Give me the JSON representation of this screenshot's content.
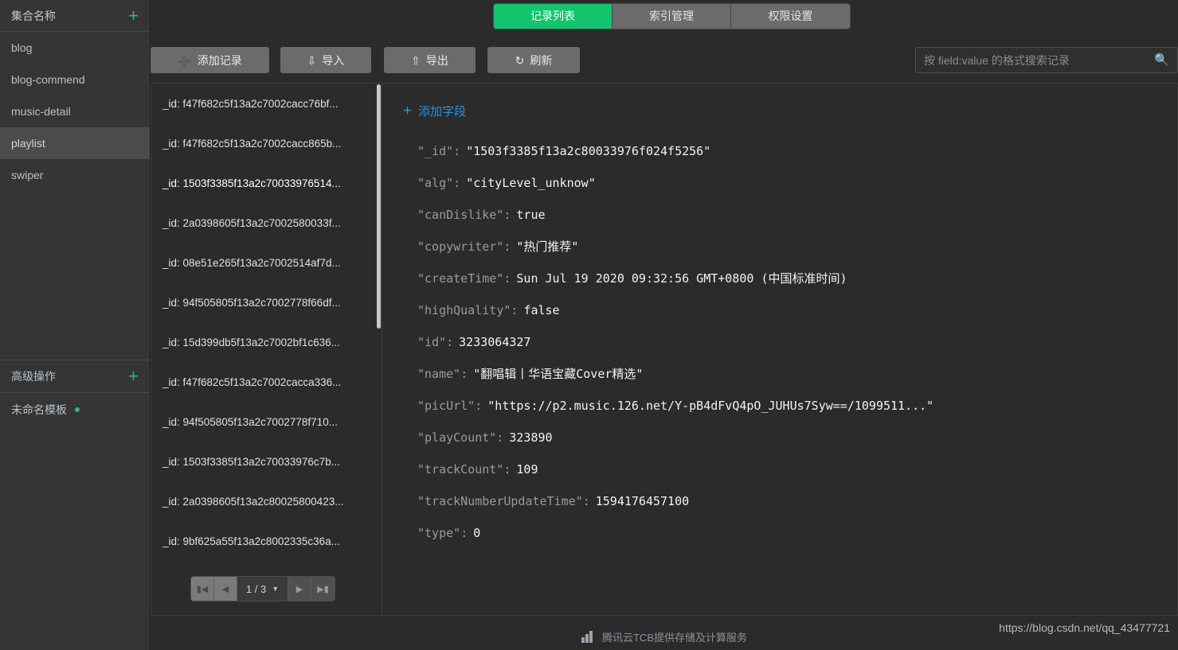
{
  "sidebar": {
    "header": {
      "title": "集合名称",
      "add_icon": "plus-icon"
    },
    "collections": [
      {
        "label": "blog",
        "active": false
      },
      {
        "label": "blog-commend",
        "active": false
      },
      {
        "label": "music-detail",
        "active": false
      },
      {
        "label": "playlist",
        "active": true
      },
      {
        "label": "swiper",
        "active": false
      }
    ],
    "advanced": {
      "title": "高级操作",
      "add_icon": "plus-icon"
    },
    "template": {
      "label": "未命名模板",
      "status_color": "#2eb87a"
    }
  },
  "tabs": [
    {
      "label": "记录列表",
      "active": true
    },
    {
      "label": "索引管理",
      "active": false
    },
    {
      "label": "权限设置",
      "active": false
    }
  ],
  "toolbar": {
    "add_record": {
      "label": "添加记录",
      "icon": "plus-icon"
    },
    "import": {
      "label": "导入",
      "icon": "download-arrow-icon"
    },
    "export": {
      "label": "导出",
      "icon": "upload-arrow-icon"
    },
    "refresh": {
      "label": "刷新",
      "icon": "refresh-icon"
    }
  },
  "search": {
    "placeholder": "按 field:value 的格式搜索记录",
    "value": "",
    "icon": "search-icon"
  },
  "record_list": [
    {
      "label": "_id: f47f682c5f13a2c7002cacc76bf...",
      "selected": false
    },
    {
      "label": "_id: f47f682c5f13a2c7002cacc865b...",
      "selected": false
    },
    {
      "label": "_id: 1503f3385f13a2c70033976514...",
      "selected": true
    },
    {
      "label": "_id: 2a0398605f13a2c7002580033f...",
      "selected": false
    },
    {
      "label": "_id: 08e51e265f13a2c7002514af7d...",
      "selected": false
    },
    {
      "label": "_id: 94f505805f13a2c7002778f66df...",
      "selected": false
    },
    {
      "label": "_id: 15d399db5f13a2c7002bf1c636...",
      "selected": false
    },
    {
      "label": "_id: f47f682c5f13a2c7002cacca336...",
      "selected": false
    },
    {
      "label": "_id: 94f505805f13a2c7002778f710...",
      "selected": false
    },
    {
      "label": "_id: 1503f3385f13a2c70033976c7b...",
      "selected": false
    },
    {
      "label": "_id: 2a0398605f13a2c80025800423...",
      "selected": false
    },
    {
      "label": "_id: 9bf625a55f13a2c8002335c36a...",
      "selected": false
    }
  ],
  "pagination": {
    "first_icon": "first-page-icon",
    "prev_icon": "prev-page-icon",
    "page_text": "1 / 3",
    "caret_icon": "chevron-down-icon",
    "next_icon": "next-page-icon",
    "last_icon": "last-page-icon",
    "first_disabled": true,
    "prev_disabled": true
  },
  "detail": {
    "add_field": {
      "label": "添加字段",
      "icon": "plus-icon",
      "color": "#2f8fd6"
    },
    "fields": [
      {
        "key": "\"_id\"",
        "value": "\"1503f3385f13a2c80033976f024f5256\""
      },
      {
        "key": "\"alg\"",
        "value": "\"cityLevel_unknow\""
      },
      {
        "key": "\"canDislike\"",
        "value": "true"
      },
      {
        "key": "\"copywriter\"",
        "value": "\"热门推荐\""
      },
      {
        "key": "\"createTime\"",
        "value": "Sun Jul 19 2020 09:32:56 GMT+0800 (中国标准时间)"
      },
      {
        "key": "\"highQuality\"",
        "value": "false"
      },
      {
        "key": "\"id\"",
        "value": "3233064327"
      },
      {
        "key": "\"name\"",
        "value": "\"翻唱辑丨华语宝藏Cover精选\""
      },
      {
        "key": "\"picUrl\"",
        "value": "\"https://p2.music.126.net/Y-pB4dFvQ4pO_JUHUs7Syw==/1099511...\""
      },
      {
        "key": "\"playCount\"",
        "value": "323890"
      },
      {
        "key": "\"trackCount\"",
        "value": "109"
      },
      {
        "key": "\"trackNumberUpdateTime\"",
        "value": "1594176457100"
      },
      {
        "key": "\"type\"",
        "value": "0"
      }
    ]
  },
  "footer": {
    "text": "腾讯云TCB提供存储及计算服务",
    "logo": "bar-chart-logo-icon"
  },
  "watermark": {
    "text": "https://blog.csdn.net/qq_43477721"
  },
  "colors": {
    "accent_green": "#14c46e",
    "link_blue": "#2f8fd6",
    "sidebar_bg": "#353535",
    "main_bg": "#2b2b2b",
    "button_bg": "#6b6b6b"
  }
}
